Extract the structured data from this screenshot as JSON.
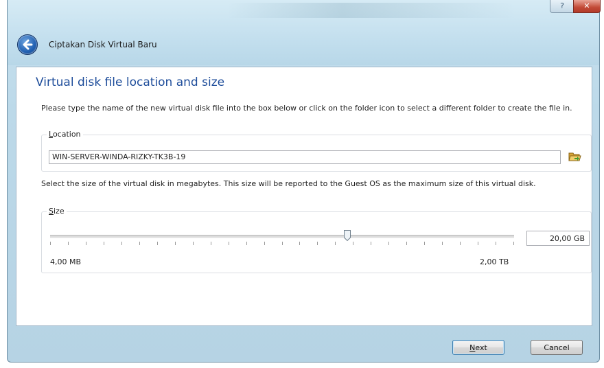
{
  "window": {
    "title": "Ciptakan Disk Virtual Baru",
    "help_label": "?",
    "close_label": "✕"
  },
  "page": {
    "heading": "Virtual disk file location and size",
    "location_description": "Please type the name of the new virtual disk file into the box below or click on the folder icon to select a different folder to create the file in.",
    "size_description": "Select the size of the virtual disk in megabytes. This size will be reported to the Guest OS as the maximum size of this virtual disk."
  },
  "location": {
    "group_label_prefix": "",
    "group_label_mnemonic": "L",
    "group_label_rest": "ocation",
    "value": "WIN-SERVER-WINDA-RIZKY-TK3B-19",
    "folder_icon": "folder-open-icon"
  },
  "size": {
    "group_label_mnemonic": "S",
    "group_label_rest": "ize",
    "value": "20,00 GB",
    "min_label": "4,00 MB",
    "max_label": "2,00 TB",
    "slider_fraction": 0.64,
    "tick_count": 27
  },
  "buttons": {
    "next_mnemonic": "N",
    "next_rest": "ext",
    "cancel": "Cancel"
  },
  "colors": {
    "heading": "#1d4c9a",
    "accent": "#1f5fb1"
  }
}
